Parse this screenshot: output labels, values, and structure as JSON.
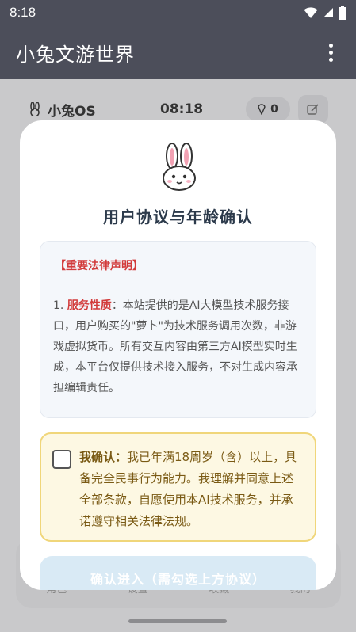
{
  "status_bar": {
    "time": "8:18"
  },
  "app_bar": {
    "title": "小兔文游世界"
  },
  "background": {
    "brand": "小兔OS",
    "time": "08:18",
    "carrot_count": "0",
    "nav_items": [
      "角色",
      "设置",
      "收藏",
      "我的"
    ]
  },
  "modal": {
    "title": "用户协议与年龄确认",
    "legal": {
      "heading": "【重要法律声明】",
      "item_prefix": "1. ",
      "item_keyword": "服务性质",
      "item_text": "：本站提供的是AI大模型技术服务接口，用户购买的\"萝卜\"为技术服务调用次数，非游戏虚拟货币。所有交互内容由第三方AI模型实时生成，本平台仅提供技术接入服务，不对生成内容承担编辑责任。"
    },
    "confirm": {
      "lead": "我确认：",
      "text": "我已年满18周岁（含）以上，具备完全民事行为能力。我理解并同意上述全部条款，自愿使用本AI技术服务，并承诺遵守相关法律法规。",
      "checked": false
    },
    "enter_button": "确认进入（需勾选上方协议）"
  },
  "colors": {
    "app_bar": "#4c4e5a",
    "warning_red": "#d23b3b",
    "confirm_bg": "#fdf8e3",
    "confirm_border": "#f0d67a",
    "button_disabled": "#d9eaf5"
  }
}
